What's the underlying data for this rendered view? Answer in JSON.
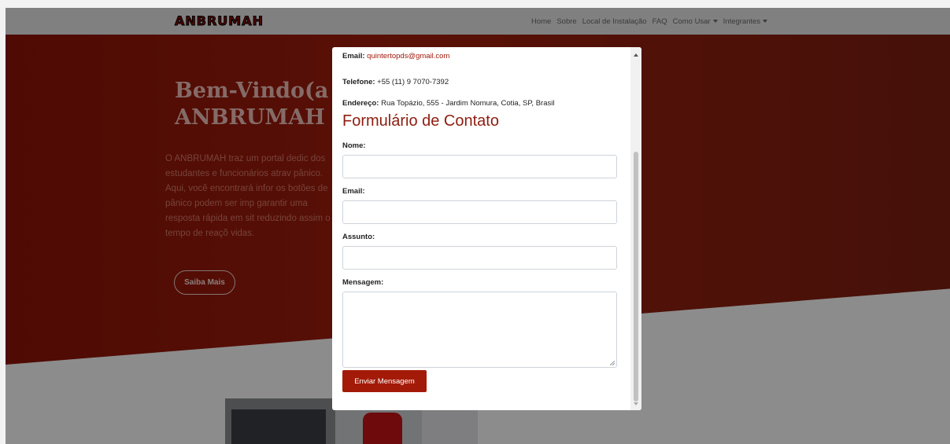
{
  "navbar": {
    "brand": "ANBRUMAH",
    "links": [
      {
        "label": "Home"
      },
      {
        "label": "Sobre"
      },
      {
        "label": "Local de Instalação"
      },
      {
        "label": "FAQ"
      },
      {
        "label": "Como Usar",
        "dropdown": true
      },
      {
        "label": "Integrantes",
        "dropdown": true
      }
    ]
  },
  "hero": {
    "title_line1": "Bem-Vindo(a",
    "title_line2": "ANBRUMAH",
    "paragraph": "O ANBRUMAH traz um portal dedic dos estudantes e funcionários atrav pânico. Aqui, você encontrará infor os botões de pânico podem ser imp garantir uma resposta rápida em sit reduzindo assim o tempo de reaçõ vidas.",
    "button_label": "Saiba Mais"
  },
  "modal": {
    "contact_info": {
      "email_label": "Email:",
      "email_value": "quintertopds@gmail.com",
      "phone_label": "Telefone:",
      "phone_value": "+55 (11) 9 7070-7392",
      "address_label": "Endereço:",
      "address_value": "Rua Topázio, 555 - Jardim Nomura, Cotia, SP, Brasil"
    },
    "form": {
      "title": "Formulário de Contato",
      "name_label": "Nome:",
      "name_value": "",
      "email_label": "Email:",
      "email_value": "",
      "subject_label": "Assunto:",
      "subject_value": "",
      "message_label": "Mensagem:",
      "message_value": "",
      "submit_label": "Enviar Mensagem"
    }
  },
  "colors": {
    "accent": "#a41a08",
    "hero_red": "#8f1307",
    "title_red": "#8e1d10",
    "nav_bg": "#e9e9e9"
  }
}
